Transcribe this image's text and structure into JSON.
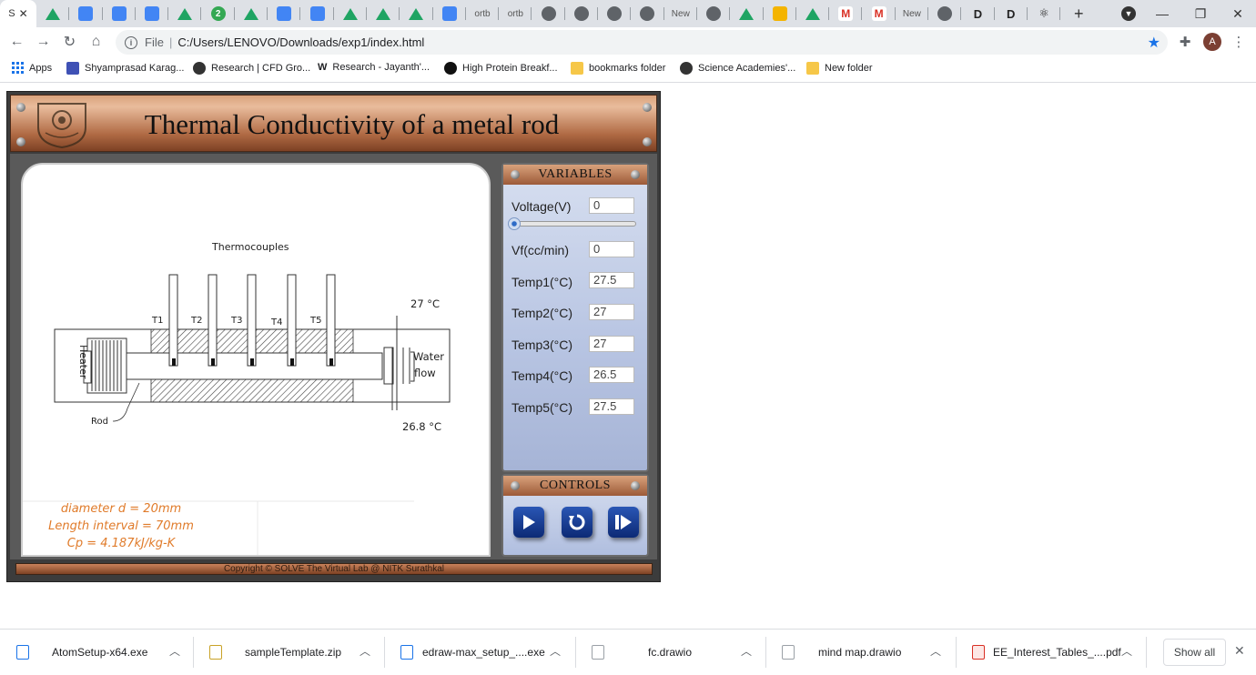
{
  "browser": {
    "active_tab_label": "S",
    "tabs": [
      {
        "icon": "drive-icon"
      },
      {
        "icon": "docs-icon"
      },
      {
        "icon": "docs-icon"
      },
      {
        "icon": "docs-icon"
      },
      {
        "icon": "drive-icon"
      },
      {
        "icon": "number-icon",
        "text": "2"
      },
      {
        "icon": "drive-icon"
      },
      {
        "icon": "docs-icon"
      },
      {
        "icon": "docs-icon"
      },
      {
        "icon": "drive-icon"
      },
      {
        "icon": "drive-icon"
      },
      {
        "icon": "drive-icon"
      },
      {
        "icon": "docs-icon"
      },
      {
        "icon": "text-icon",
        "text": "ortb"
      },
      {
        "icon": "text-icon",
        "text": "ortb"
      },
      {
        "icon": "globe-icon"
      },
      {
        "icon": "globe-icon"
      },
      {
        "icon": "globe-icon"
      },
      {
        "icon": "globe-icon"
      },
      {
        "icon": "text-icon",
        "text": "New"
      },
      {
        "icon": "globe-icon"
      },
      {
        "icon": "drive-icon"
      },
      {
        "icon": "slides-icon"
      },
      {
        "icon": "drive-icon"
      },
      {
        "icon": "gmail-icon",
        "text": "M"
      },
      {
        "icon": "gmail-icon",
        "text": "M"
      },
      {
        "icon": "text-icon",
        "text": "New"
      },
      {
        "icon": "globe-icon"
      },
      {
        "icon": "d-icon",
        "text": "D"
      },
      {
        "icon": "d-icon",
        "text": "D"
      },
      {
        "icon": "react-icon",
        "text": "⚛"
      }
    ],
    "new_tab_symbol": "+",
    "url_scheme": "File",
    "url_path": "C:/Users/LENOVO/Downloads/exp1/index.html",
    "profile_initial": "A"
  },
  "bookmarks": [
    {
      "label": "Apps",
      "icon": "apps-grid-icon"
    },
    {
      "label": "Shyamprasad Karag...",
      "icon": "docs-icon"
    },
    {
      "label": "Research | CFD Gro...",
      "icon": "globe-icon"
    },
    {
      "label": "Research - Jayanth'...",
      "icon": "w-icon"
    },
    {
      "label": "High Protein Breakf...",
      "icon": "dark-circle-icon"
    },
    {
      "label": "bookmarks folder",
      "icon": "folder-icon"
    },
    {
      "label": "Science Academies'...",
      "icon": "globe-icon"
    },
    {
      "label": "New folder",
      "icon": "folder-icon"
    }
  ],
  "sim": {
    "title": "Thermal Conductivity of a metal rod",
    "variables_title": "VARIABLES",
    "controls_title": "CONTROLS",
    "copyright": "Copyright © SOLVE The Virtual Lab @ NITK Surathkal",
    "variables": [
      {
        "label": "Voltage(V)",
        "value": "0"
      },
      {
        "label": "Vf(cc/min)",
        "value": "0"
      },
      {
        "label": "Temp1(°C)",
        "value": "27.5"
      },
      {
        "label": "Temp2(°C)",
        "value": "27"
      },
      {
        "label": "Temp3(°C)",
        "value": "27"
      },
      {
        "label": "Temp4(°C)",
        "value": "26.5"
      },
      {
        "label": "Temp5(°C)",
        "value": "27.5"
      }
    ],
    "slider_value": 0,
    "diagram": {
      "thermocouples_label": "Thermocouples",
      "tc_labels": [
        "T1",
        "T2",
        "T3",
        "T4",
        "T5"
      ],
      "heater_label": "Heater",
      "rod_label": "Rod",
      "water_label_1": "Water",
      "water_label_2": "flow",
      "temp_in": "27 °C",
      "temp_out": "26.8 °C"
    },
    "info": [
      "diameter d = 20mm",
      "Length interval = 70mm",
      "Cp = 4.187kJ/kg-K"
    ]
  },
  "downloads": [
    {
      "name": "AtomSetup-x64.exe"
    },
    {
      "name": "sampleTemplate.zip"
    },
    {
      "name": "edraw-max_setup_....exe"
    },
    {
      "name": "fc.drawio"
    },
    {
      "name": "mind map.drawio"
    },
    {
      "name": "EE_Interest_Tables_....pdf"
    }
  ],
  "show_all_label": "Show all",
  "colors": {
    "accent": "#1a73e8",
    "info_text": "#e07b2a",
    "copper": "#b06a44",
    "control_blue": "#1c3f96"
  }
}
